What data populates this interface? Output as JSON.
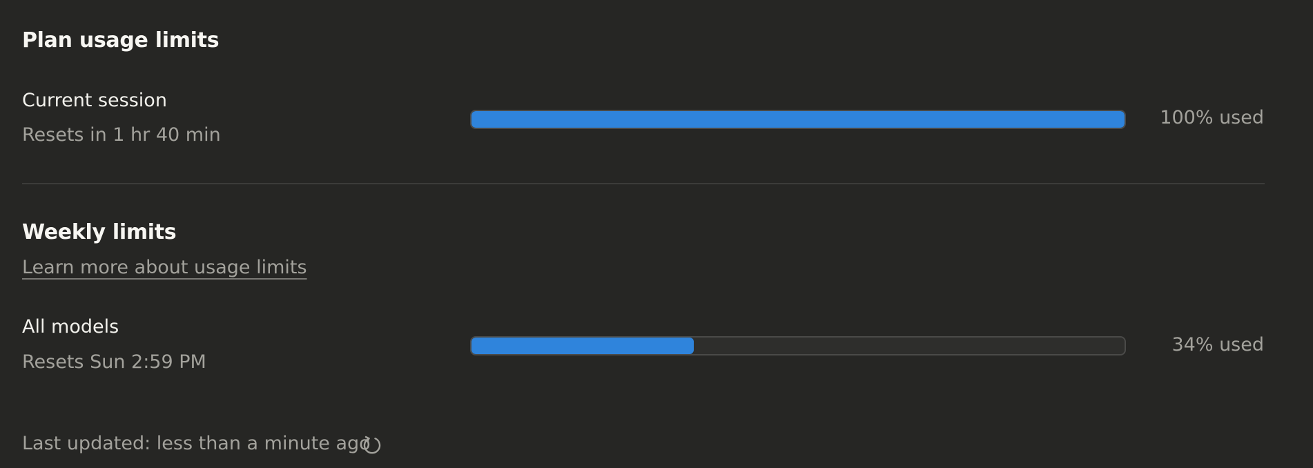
{
  "plan": {
    "title": "Plan usage limits",
    "current_session": {
      "label": "Current session",
      "resets": "Resets in 1 hr 40 min",
      "usage_text": "100% used",
      "usage_fraction": 1.0
    }
  },
  "weekly": {
    "title": "Weekly limits",
    "learn_more": "Learn more about usage limits",
    "all_models": {
      "label": "All models",
      "resets": "Resets Sun 2:59 PM",
      "usage_text": "34% used",
      "usage_fraction": 0.34
    }
  },
  "footer": {
    "last_updated": "Last updated: less than a minute ago",
    "refresh_icon": "refresh-icon"
  },
  "colors": {
    "background": "#262624",
    "bar_fill": "#2f84dc",
    "bar_track": "#2e2e2c",
    "muted_text": "#a3a29c"
  }
}
